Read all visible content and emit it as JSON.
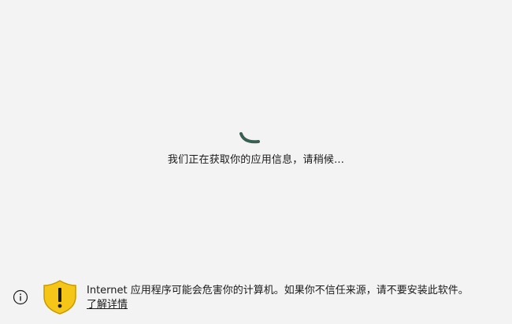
{
  "loading": {
    "message": "我们正在获取你的应用信息，请稍候..."
  },
  "footer": {
    "warning": "Internet 应用程序可能会危害你的计算机。如果你不信任来源，请不要安装此软件。",
    "learn_more": "了解详情",
    "icons": {
      "info": "info-icon",
      "shield": "warning-shield-icon"
    }
  },
  "colors": {
    "background": "#f3f3f3",
    "spinner": "#3a5f52",
    "shield_yellow": "#f5c518",
    "shield_outline": "#c99a00"
  }
}
